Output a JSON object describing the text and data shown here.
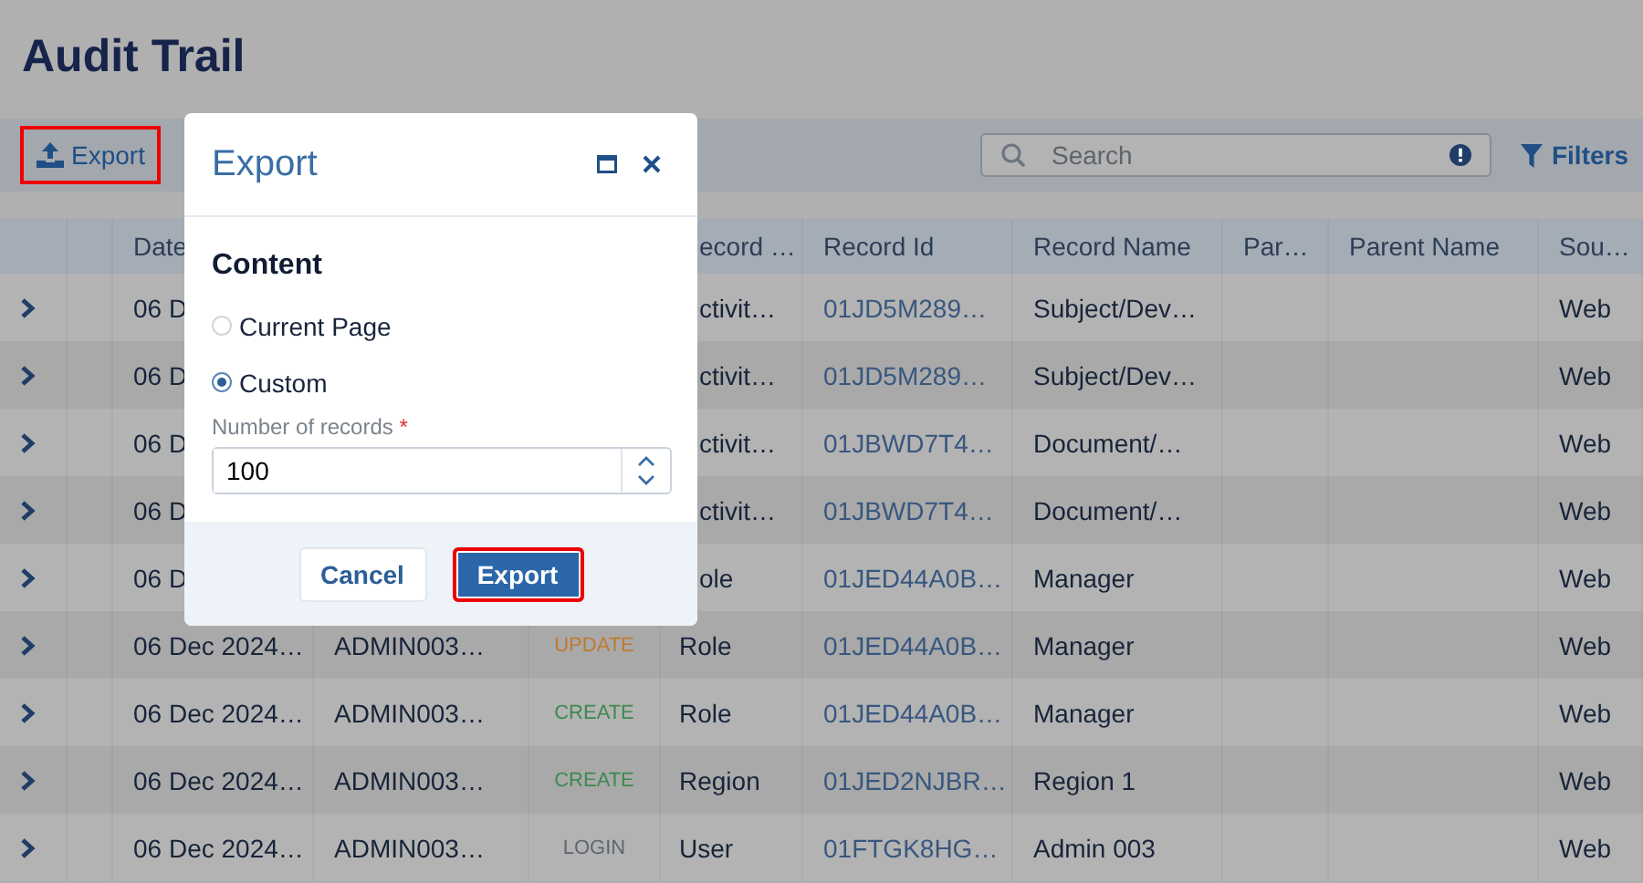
{
  "page": {
    "title": "Audit Trail"
  },
  "toolbar": {
    "export_button": "Export",
    "search": {
      "placeholder": "Search"
    },
    "filters_button": "Filters"
  },
  "table": {
    "columns": [
      "",
      "",
      "Date",
      "",
      "",
      "ecord …",
      "Record Id",
      "Record Name",
      "Par…",
      "Parent Name",
      "Sou…"
    ],
    "rows": [
      {
        "date": "06 D",
        "record_type": "ctivit…",
        "record_id": "01JD5M289…",
        "record_name": "Subject/Dev…",
        "source": "Web"
      },
      {
        "date": "06 D",
        "record_type": "ctivit…",
        "record_id": "01JD5M289…",
        "record_name": "Subject/Dev…",
        "source": "Web"
      },
      {
        "date": "06 D",
        "record_type": "ctivit…",
        "record_id": "01JBWD7T4…",
        "record_name": "Document/…",
        "source": "Web"
      },
      {
        "date": "06 D",
        "record_type": "ctivit…",
        "record_id": "01JBWD7T4…",
        "record_name": "Document/…",
        "source": "Web"
      },
      {
        "date": "06 D",
        "record_type": "ole",
        "record_id": "01JED44A0B…",
        "record_name": "Manager",
        "source": "Web"
      },
      {
        "date": "06 Dec 2024…",
        "user": "ADMIN003…",
        "action": {
          "text": "UPDATE",
          "color": "#c07a30"
        },
        "record_type": "Role",
        "record_id": "01JED44A0B…",
        "record_name": "Manager",
        "source": "Web"
      },
      {
        "date": "06 Dec 2024…",
        "user": "ADMIN003…",
        "action": {
          "text": "CREATE",
          "color": "#3c8a4f"
        },
        "record_type": "Role",
        "record_id": "01JED44A0B…",
        "record_name": "Manager",
        "source": "Web"
      },
      {
        "date": "06 Dec 2024…",
        "user": "ADMIN003…",
        "action": {
          "text": "CREATE",
          "color": "#3c8a4f"
        },
        "record_type": "Region",
        "record_id": "01JED2NJBR…",
        "record_name": "Region 1",
        "source": "Web"
      },
      {
        "date": "06 Dec 2024…",
        "user": "ADMIN003…",
        "action": {
          "text": "LOGIN",
          "color": "#5f6670"
        },
        "record_type": "User",
        "record_id": "01FTGK8HG…",
        "record_name": "Admin 003",
        "source": "Web"
      }
    ]
  },
  "dialog": {
    "title": "Export",
    "section": "Content",
    "options": [
      {
        "label": "Current Page",
        "selected": false
      },
      {
        "label": "Custom",
        "selected": true
      }
    ],
    "field": {
      "label": "Number of records",
      "required_mark": "*",
      "value": "100"
    },
    "buttons": [
      {
        "label": "Cancel",
        "kind": "secondary"
      },
      {
        "label": "Export",
        "kind": "primary"
      }
    ]
  }
}
